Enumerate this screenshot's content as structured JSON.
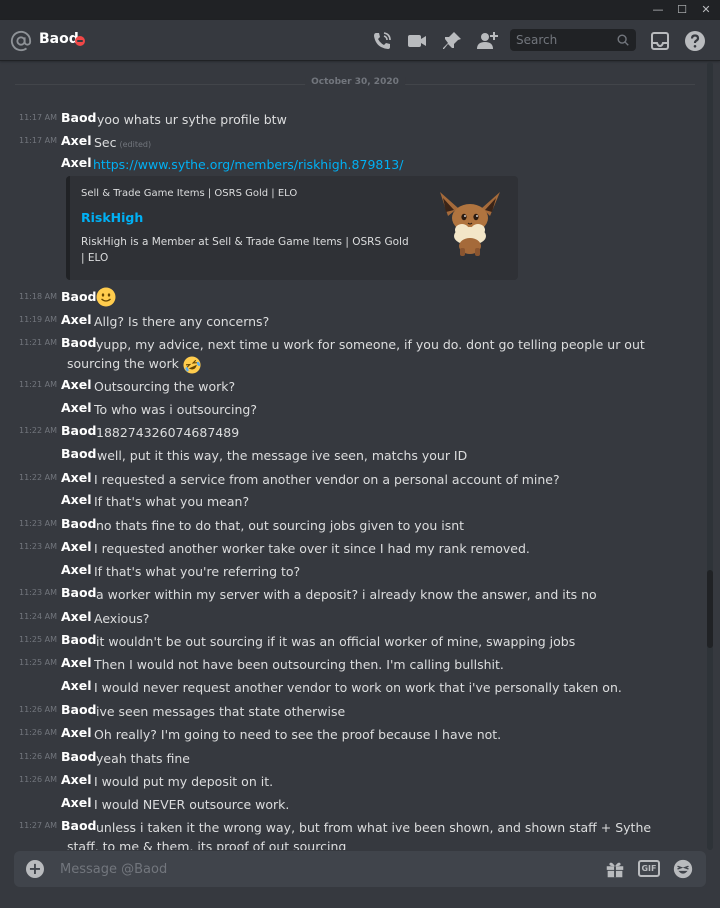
{
  "window": {
    "minimize_glyph": "—",
    "maximize_glyph": "☐",
    "close_glyph": "✕"
  },
  "header": {
    "channel_name": "Baod",
    "status": "dnd",
    "status_color": "#f04747",
    "icons": [
      "call-icon",
      "video-icon",
      "pin-icon",
      "add-friend-icon",
      "inbox-icon",
      "help-icon"
    ],
    "search_placeholder": "Search"
  },
  "chat": {
    "date_divider": "October 30, 2020",
    "messages": [
      {
        "time": "11:17 AM",
        "author": "Baod",
        "text": "yoo whats ur sythe profile btw"
      },
      {
        "time": "11:17 AM",
        "author": "Axel",
        "text": "Sec",
        "edited": "(edited)"
      },
      {
        "time": "",
        "author": "Axel",
        "link": "https://www.sythe.org/members/riskhigh.879813/"
      },
      {
        "time": "11:18 AM",
        "author": "Baod",
        "emoji": "slightly-smiling-face"
      },
      {
        "time": "11:19 AM",
        "author": "Axel",
        "text": "Allg? Is there any concerns?"
      },
      {
        "time": "11:21 AM",
        "author": "Baod",
        "text": "yupp, my advice, next time u work for someone, if you do. dont go telling people ur out sourcing the work",
        "emoji": "rolling-on-floor-laughing"
      },
      {
        "time": "11:21 AM",
        "author": "Axel",
        "text": "Outsourcing the work?"
      },
      {
        "time": "",
        "author": "Axel",
        "text": "To who was i outsourcing?"
      },
      {
        "time": "11:22 AM",
        "author": "Baod",
        "text": "188274326074687489"
      },
      {
        "time": "",
        "author": "Baod",
        "text": "well, put it this way, the message ive seen, matchs your ID"
      },
      {
        "time": "11:22 AM",
        "author": "Axel",
        "text": "I requested a service from another vendor on a personal account of mine?"
      },
      {
        "time": "",
        "author": "Axel",
        "text": "If that's what you mean?"
      },
      {
        "time": "11:23 AM",
        "author": "Baod",
        "text": "no thats fine to do that, out sourcing jobs given to you isnt"
      },
      {
        "time": "11:23 AM",
        "author": "Axel",
        "text": "I requested another worker take over it since I had my rank removed."
      },
      {
        "time": "",
        "author": "Axel",
        "text": "If that's what you're referring to?"
      },
      {
        "time": "11:23 AM",
        "author": "Baod",
        "text": "a worker within my server with a deposit? i already know the answer, and its no"
      },
      {
        "time": "11:24 AM",
        "author": "Axel",
        "text": "Aexious?"
      },
      {
        "time": "11:25 AM",
        "author": "Baod",
        "text": "it wouldn't be out sourcing if it was an official worker of mine, swapping jobs"
      },
      {
        "time": "11:25 AM",
        "author": "Axel",
        "text": "Then I would not have been outsourcing then. I'm calling bullshit."
      },
      {
        "time": "",
        "author": "Axel",
        "text": "I would never request another vendor to work on work that i've personally taken on."
      },
      {
        "time": "11:26 AM",
        "author": "Baod",
        "text": "ive seen messages that state otherwise"
      },
      {
        "time": "11:26 AM",
        "author": "Axel",
        "text": "Oh really? I'm going to need to see the proof because I have not."
      },
      {
        "time": "11:26 AM",
        "author": "Baod",
        "text": "yeah thats fine"
      },
      {
        "time": "11:26 AM",
        "author": "Axel",
        "text": "I would put my deposit on it."
      },
      {
        "time": "",
        "author": "Axel",
        "text": "I would NEVER outsource work."
      },
      {
        "time": "11:27 AM",
        "author": "Baod",
        "text": "unless i taken it the wrong way, but from what ive been shown, and shown staff + Sythe staff, to me & them, its proof of out sourcing"
      }
    ],
    "embed": {
      "provider": "Sell & Trade Game Items | OSRS Gold | ELO",
      "title": "RiskHigh",
      "description": "RiskHigh is a Member at Sell & Trade Game Items | OSRS Gold | ELO",
      "thumbnail": "eevee-avatar"
    }
  },
  "composer": {
    "placeholder": "Message @Baod",
    "gif_label": "GIF",
    "icons": [
      "add-attachment-icon",
      "gift-icon",
      "gif-icon",
      "emoji-icon"
    ]
  },
  "colors": {
    "background": "#36393f",
    "titlebar": "#202225",
    "link": "#00b0f4",
    "input": "#40444b"
  }
}
